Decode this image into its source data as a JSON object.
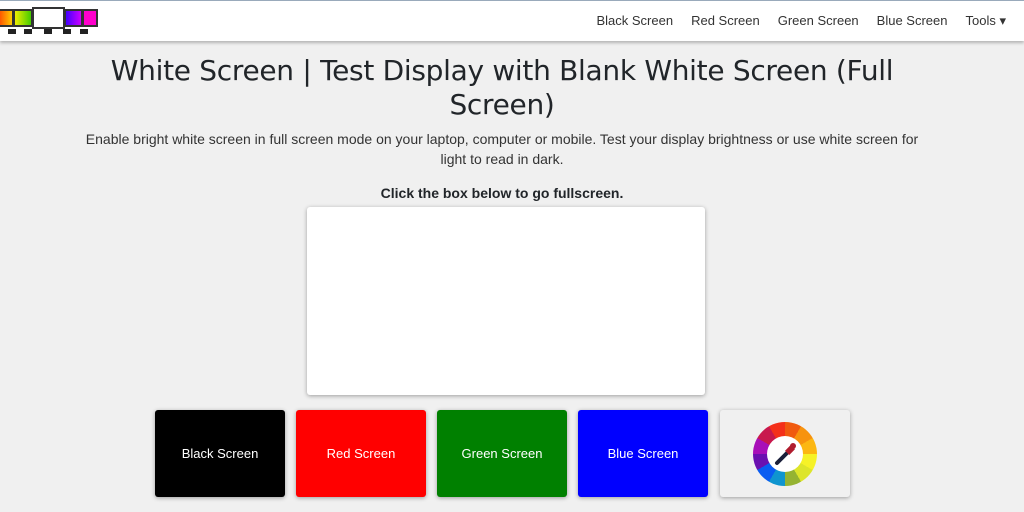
{
  "nav": {
    "links": [
      "Black Screen",
      "Red Screen",
      "Green Screen",
      "Blue Screen",
      "Tools ▾"
    ]
  },
  "logo": {
    "colors": [
      "#ff6a00",
      "#88e000",
      "#ffffff",
      "#6000ff",
      "#ff00c0"
    ]
  },
  "title": "White Screen | Test Display with Blank White Screen (Full Screen)",
  "subtitle": "Enable bright white screen in full screen mode on your laptop, computer or mobile. Test your display brightness or use white screen for light to read in dark.",
  "hint": "Click the box below to go fullscreen.",
  "buttons": [
    {
      "label": "Black Screen",
      "color": "#000000"
    },
    {
      "label": "Red Screen",
      "color": "#ff0000"
    },
    {
      "label": "Green Screen",
      "color": "#008000"
    },
    {
      "label": "Blue Screen",
      "color": "#0000ff"
    }
  ],
  "picker": {
    "icon": "color-picker-icon"
  }
}
